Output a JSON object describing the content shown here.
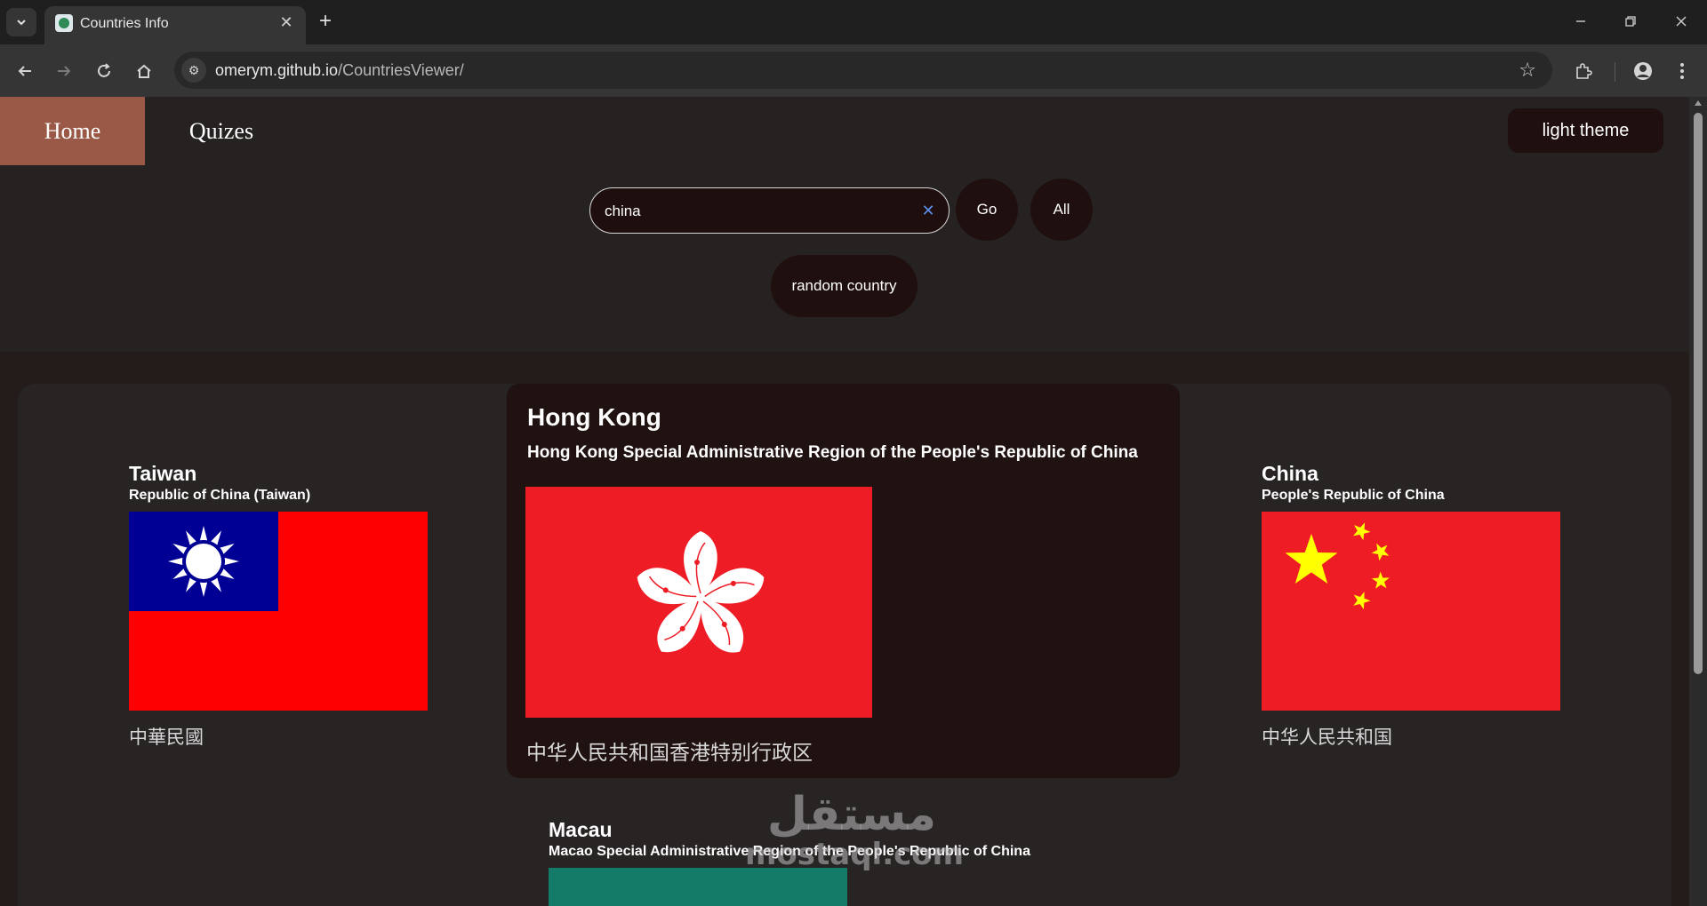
{
  "browser": {
    "tab_title": "Countries Info",
    "url_host": "omerym.github.io",
    "url_path": "/CountriesViewer/"
  },
  "nav": {
    "home": "Home",
    "quizes": "Quizes",
    "theme_button": "light theme"
  },
  "search": {
    "value": "china",
    "go_label": "Go",
    "all_label": "All",
    "random_label": "random country"
  },
  "results": [
    {
      "name": "Taiwan",
      "official": "Republic of China (Taiwan)",
      "native": "中華民國",
      "flag": "taiwan-flag"
    },
    {
      "name": "Hong Kong",
      "official": "Hong Kong Special Administrative Region of the People's Republic of China",
      "native": "中华人民共和国香港特别行政区",
      "flag": "hong-kong-flag"
    },
    {
      "name": "China",
      "official": "People's Republic of China",
      "native": "中华人民共和国",
      "flag": "china-flag"
    },
    {
      "name": "Macau",
      "official": "Macao Special Administrative Region of the People's Republic of China",
      "flag": "macau-flag"
    }
  ],
  "watermark": {
    "arabic": "مستقل",
    "latin": "mostaql.com"
  },
  "colors": {
    "accent_home": "#9a5946",
    "button_bg": "#1f0f0e",
    "page_bg": "#262222",
    "flag_red_taiwan": "#fe0000",
    "flag_blue_taiwan": "#000095",
    "flag_red_prc": "#ee1c25",
    "flag_yellow_prc": "#ffff00",
    "flag_green_macau": "#137b68"
  }
}
